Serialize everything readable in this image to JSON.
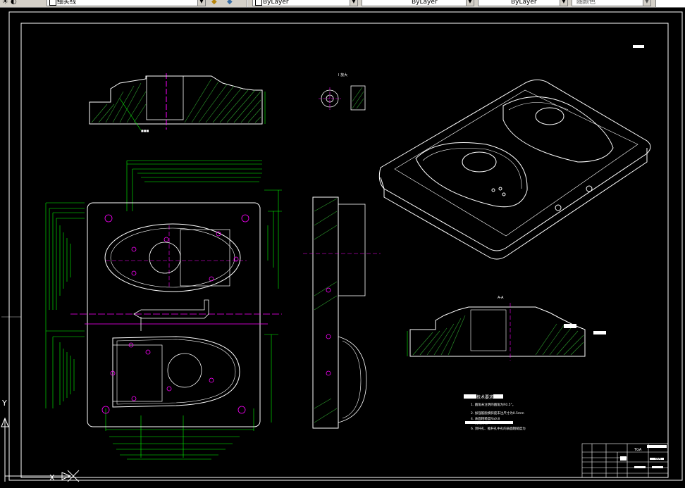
{
  "toolbar": {
    "layer_name": "细实线",
    "color_value": "ByLayer",
    "linetype_value": "ByLayer",
    "lineweight_value": "ByLayer",
    "plotstyle_value": "随颜色"
  },
  "drawing": {
    "detail_label": "I 放大",
    "section_label": "A-A",
    "tech_title": "技术要求",
    "tech_lines": [
      "1. 圆角未注明的圆角为R0.5°。",
      "2. 加强筋脱模斜度未注尺寸为0.5mm",
      "4. 表面粗糙度Ra0.8",
      "5. 锐角倒钝",
      "6. 顶杆孔、推杆孔中孔的表面粗糙度为"
    ],
    "title_block": {
      "code": "TGA",
      "label": "模具"
    }
  },
  "ucs": {
    "y_label": "Y",
    "x_label": "X"
  }
}
